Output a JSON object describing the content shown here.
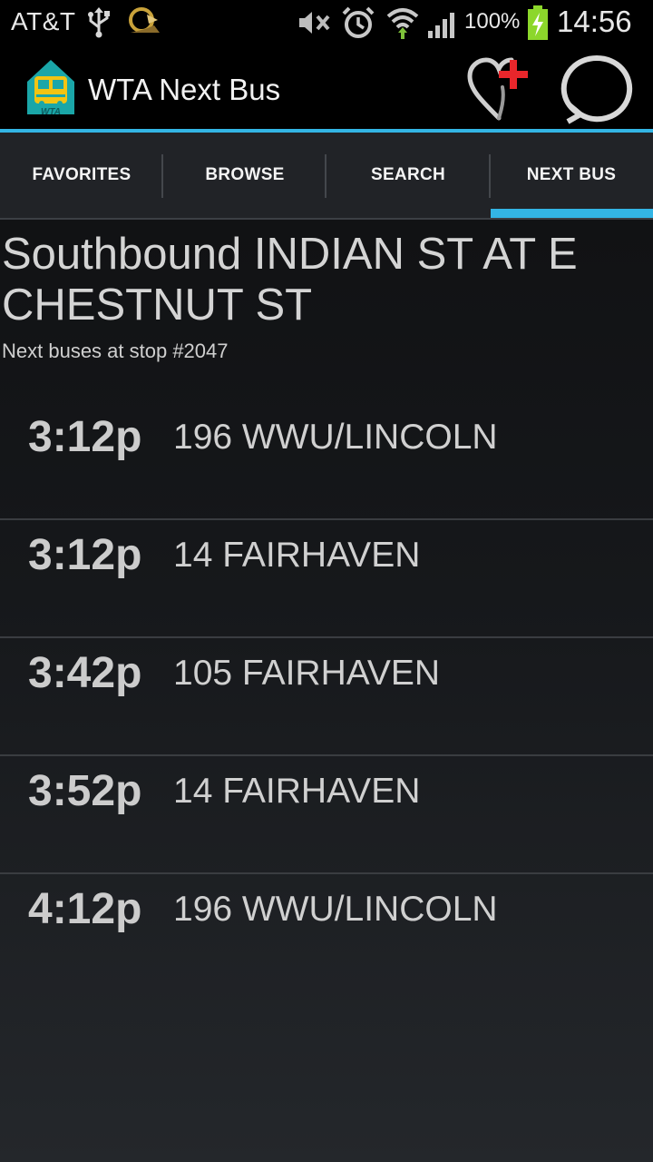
{
  "status_bar": {
    "carrier": "AT&T",
    "battery_percent": "100%",
    "clock": "14:56",
    "icons": [
      "usb-icon",
      "app-notification-icon",
      "mute-icon",
      "alarm-icon",
      "wifi-icon",
      "signal-icon",
      "battery-charging-icon"
    ]
  },
  "action_bar": {
    "logo": "wta-logo",
    "title": "WTA Next Bus",
    "actions": [
      "add-favorite-icon",
      "refresh-icon"
    ]
  },
  "tabs": [
    {
      "label": "FAVORITES",
      "selected": false
    },
    {
      "label": "BROWSE",
      "selected": false
    },
    {
      "label": "SEARCH",
      "selected": false
    },
    {
      "label": "NEXT BUS",
      "selected": true
    }
  ],
  "stop": {
    "title": "Southbound INDIAN ST AT E CHESTNUT ST",
    "subtitle": "Next buses at stop #2047"
  },
  "arrivals": [
    {
      "time": "3:12p",
      "route": "196 WWU/LINCOLN"
    },
    {
      "time": "3:12p",
      "route": "14 FAIRHAVEN"
    },
    {
      "time": "3:42p",
      "route": "105 FAIRHAVEN"
    },
    {
      "time": "3:52p",
      "route": "14 FAIRHAVEN"
    },
    {
      "time": "4:12p",
      "route": "196 WWU/LINCOLN"
    }
  ],
  "colors": {
    "accent": "#33b5e5",
    "favorite_plus": "#e8262b",
    "battery": "#8cd72b",
    "logo_teal": "#1aa6a8",
    "logo_yellow": "#f2c413"
  }
}
